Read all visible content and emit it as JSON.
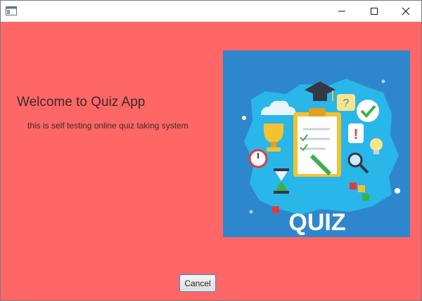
{
  "window": {
    "title": "",
    "app_icon": "window-icon",
    "controls": {
      "minimize_icon": "minimize-icon",
      "maximize_icon": "maximize-icon",
      "close_icon": "close-icon"
    }
  },
  "main": {
    "background_color": "#ff6666",
    "title": "Welcome to Quiz App",
    "subtitle": "this is self testing online quiz taking system",
    "image": {
      "label": "QUIZ",
      "background_color": "#2e87cc",
      "accent_color": "#29b6e8"
    },
    "cancel_label": "Cancel"
  }
}
